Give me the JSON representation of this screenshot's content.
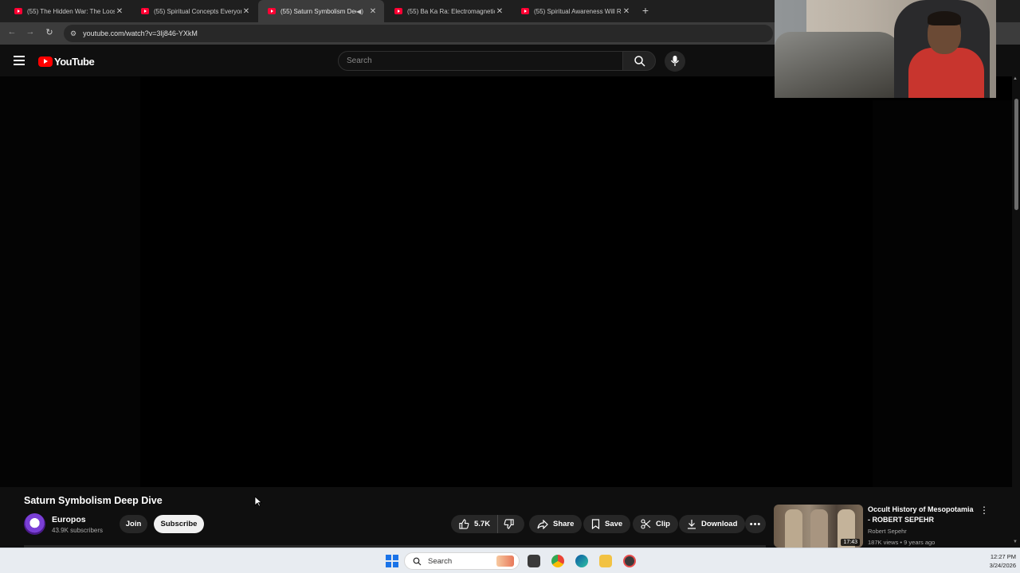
{
  "browser": {
    "tabs": [
      {
        "title": "(55) The Hidden War: The Loos",
        "active": false,
        "playing": false
      },
      {
        "title": "(55) Spiritual Concepts Everyon",
        "active": false,
        "playing": false
      },
      {
        "title": "(55) Saturn Symbolism Dee",
        "active": true,
        "playing": true
      },
      {
        "title": "(55) Ba Ka Ra: Electromagnetic",
        "active": false,
        "playing": false
      },
      {
        "title": "(55) Spiritual Awareness Will Re",
        "active": false,
        "playing": false
      }
    ],
    "new_tab": "+",
    "url": "youtube.com/watch?v=3Ij846-YXkM"
  },
  "youtube": {
    "logo_text": "YouTube",
    "search_placeholder": "Search"
  },
  "video": {
    "title": "Saturn Symbolism Deep Dive",
    "channel": "Europos",
    "subscribers": "43.9K subscribers",
    "join_label": "Join",
    "subscribe_label": "Subscribe",
    "likes": "5.7K",
    "share_label": "Share",
    "save_label": "Save",
    "clip_label": "Clip",
    "download_label": "Download",
    "more_label": "•••"
  },
  "recommended": {
    "title": "Occult History of Mesopotamia - ROBERT SEPEHR",
    "channel": "Robert Sepehr",
    "meta": "187K views • 9 years ago",
    "duration": "17:43"
  },
  "taskbar": {
    "search_label": "Search",
    "time": "12:27 PM",
    "date": "3/24/2026"
  },
  "colors": {
    "youtube_red": "#ff0000",
    "page_bg": "#0f0f0f",
    "accent_blue": "#1a73e8"
  }
}
